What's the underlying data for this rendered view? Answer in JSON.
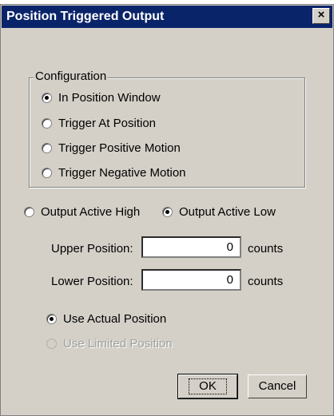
{
  "window": {
    "title": "Position Triggered Output",
    "close_glyph": "×"
  },
  "configuration": {
    "legend": "Configuration",
    "options": [
      {
        "label": "In Position Window",
        "checked": true
      },
      {
        "label": "Trigger At Position",
        "checked": false
      },
      {
        "label": "Trigger Positive Motion",
        "checked": false
      },
      {
        "label": "Trigger Negative Motion",
        "checked": false
      }
    ]
  },
  "output": {
    "active_high_label": "Output Active High",
    "active_low_label": "Output Active Low",
    "selected": "Output Active Low"
  },
  "upper": {
    "label": "Upper Position:",
    "value": "0",
    "units": "counts"
  },
  "lower": {
    "label": "Lower Position:",
    "value": "0",
    "units": "counts"
  },
  "position_source": {
    "actual_label": "Use Actual Position",
    "limited_label": "Use Limited Position",
    "selected": "Use Actual Position",
    "limited_enabled": false
  },
  "buttons": {
    "ok": "OK",
    "cancel": "Cancel"
  }
}
